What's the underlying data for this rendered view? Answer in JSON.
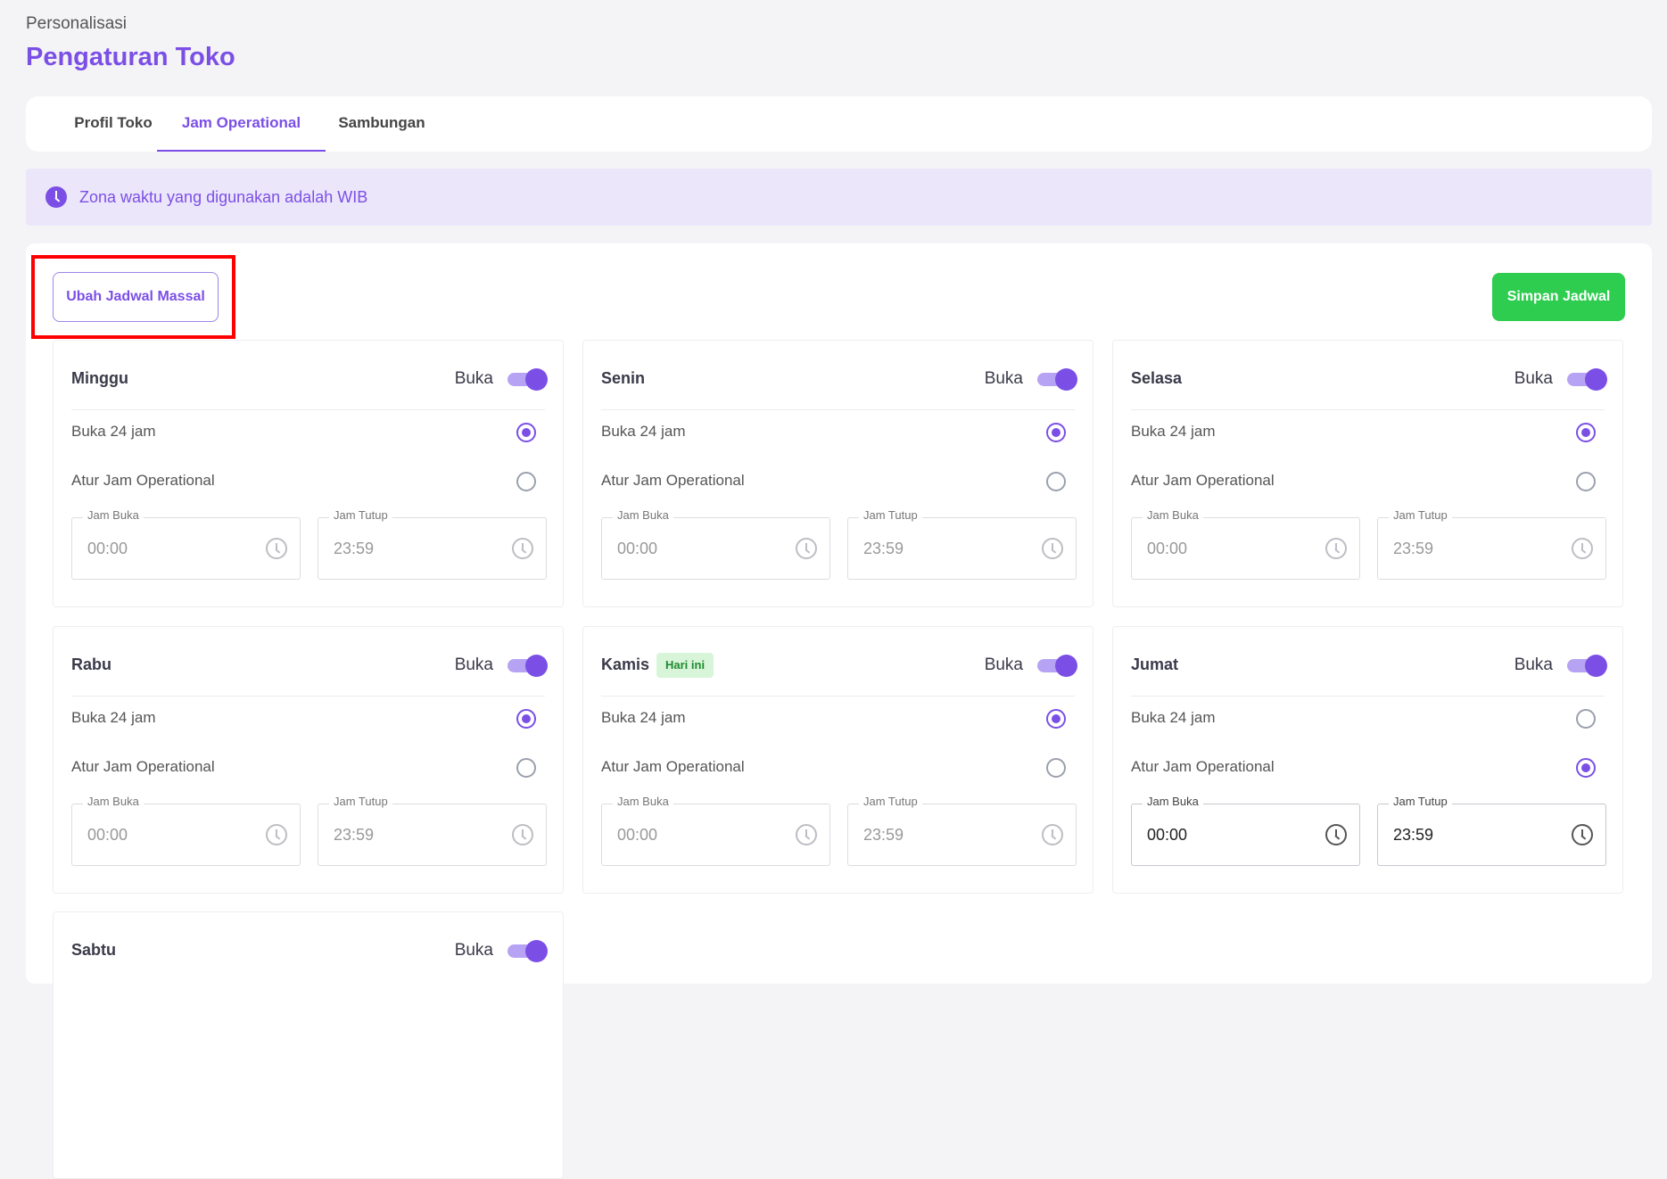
{
  "header": {
    "breadcrumb": "Personalisasi",
    "title": "Pengaturan Toko"
  },
  "tabs": [
    {
      "label": "Profil Toko",
      "active": false
    },
    {
      "label": "Jam Operational",
      "active": true
    },
    {
      "label": "Sambungan",
      "active": false
    }
  ],
  "banner": {
    "icon": "clock-icon",
    "text": "Zona waktu yang digunakan adalah WIB"
  },
  "actions": {
    "bulk_edit_label": "Ubah Jadwal Massal",
    "save_label": "Simpan Jadwal"
  },
  "labels": {
    "open": "Buka",
    "open_24h": "Buka 24 jam",
    "custom_hours": "Atur Jam Operational",
    "open_time": "Jam Buka",
    "close_time": "Jam Tutup",
    "today_badge": "Hari ini"
  },
  "days": [
    {
      "name": "Minggu",
      "open": true,
      "mode": "24h",
      "open_time": "00:00",
      "close_time": "23:59"
    },
    {
      "name": "Senin",
      "open": true,
      "mode": "24h",
      "open_time": "00:00",
      "close_time": "23:59"
    },
    {
      "name": "Selasa",
      "open": true,
      "mode": "24h",
      "open_time": "00:00",
      "close_time": "23:59"
    },
    {
      "name": "Rabu",
      "open": true,
      "mode": "24h",
      "open_time": "00:00",
      "close_time": "23:59"
    },
    {
      "name": "Kamis",
      "open": true,
      "mode": "24h",
      "open_time": "00:00",
      "close_time": "23:59",
      "today": true
    },
    {
      "name": "Jumat",
      "open": true,
      "mode": "custom",
      "open_time": "00:00",
      "close_time": "23:59"
    },
    {
      "name": "Sabtu",
      "open": true
    }
  ],
  "colors": {
    "accent": "#7b4fe6",
    "save": "#2ecc4f",
    "highlight": "#ff0000",
    "banner_bg": "#ece6fb"
  }
}
